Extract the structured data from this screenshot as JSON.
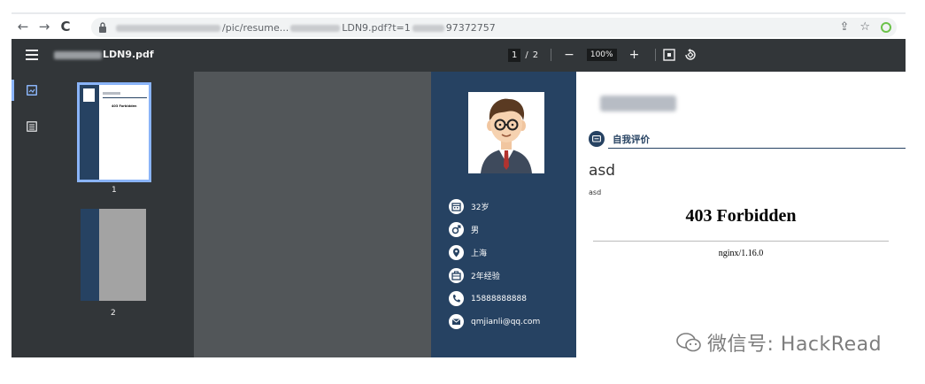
{
  "browser": {
    "url_visible_prefix": "",
    "url_visible_middle": "/pic/resume...",
    "url_visible_end": "LDN9.pdf?t=1",
    "url_visible_tail": "97372757"
  },
  "toolbar": {
    "title_suffix": "LDN9.pdf",
    "current_page": "1",
    "page_sep": "/",
    "total_pages": "2",
    "zoom_minus": "−",
    "zoom": "100%",
    "zoom_plus": "+"
  },
  "sidebar": {
    "thumbnails": [
      {
        "label": "1",
        "error_text": "403 Forbidden"
      },
      {
        "label": "2"
      }
    ]
  },
  "resume": {
    "info": [
      {
        "icon": "calendar-icon",
        "text": "32岁"
      },
      {
        "icon": "male-icon",
        "text": "男"
      },
      {
        "icon": "location-icon",
        "text": "上海"
      },
      {
        "icon": "briefcase-icon",
        "text": "2年经验"
      },
      {
        "icon": "phone-icon",
        "text": "15888888888"
      },
      {
        "icon": "email-icon",
        "text": "qmjianli@qq.com"
      }
    ],
    "section_title": "自我评价",
    "asd_big": "asd",
    "asd_small": "asd",
    "error_heading": "403 Forbidden",
    "server": "nginx/1.16.0"
  },
  "watermark": {
    "text": "微信号: HackRead"
  },
  "colors": {
    "sidebar_bg": "#323639",
    "canvas_bg": "#525659",
    "resume_blue": "#264262",
    "thumb_highlight": "#8ab4f8"
  }
}
